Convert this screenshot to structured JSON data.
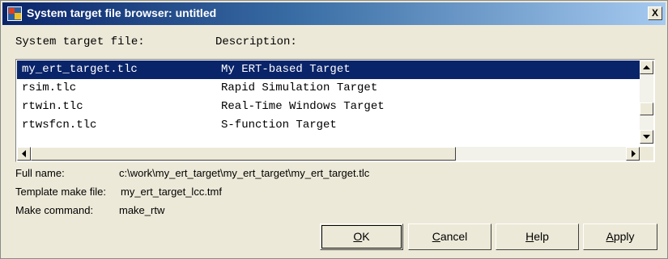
{
  "window": {
    "title": "System target file browser: untitled",
    "close_label": "X"
  },
  "columns": {
    "file": "System target file:",
    "description": "Description:"
  },
  "targets": [
    {
      "file": "my_ert_target.tlc",
      "description": "My ERT-based Target",
      "selected": true
    },
    {
      "file": "rsim.tlc",
      "description": "Rapid Simulation Target",
      "selected": false
    },
    {
      "file": "rtwin.tlc",
      "description": "Real-Time Windows Target",
      "selected": false
    },
    {
      "file": "rtwsfcn.tlc",
      "description": "S-function Target",
      "selected": false
    }
  ],
  "details": {
    "full_name_label": "Full name:",
    "full_name_value": "c:\\work\\my_ert_target\\my_ert_target\\my_ert_target.tlc",
    "template_label": "Template make file:",
    "template_value": "my_ert_target_lcc.tmf",
    "make_label": "Make command:",
    "make_value": "make_rtw"
  },
  "buttons": {
    "ok": {
      "mnemonic": "O",
      "rest": "K"
    },
    "cancel": {
      "mnemonic": "C",
      "rest": "ancel"
    },
    "help": {
      "mnemonic": "H",
      "rest": "elp"
    },
    "apply": {
      "mnemonic": "A",
      "rest": "pply"
    }
  },
  "icons": {
    "app": "simulink-app-icon",
    "close": "close-icon",
    "scroll_up": "arrow-up-icon",
    "scroll_down": "arrow-down-icon",
    "scroll_left": "arrow-left-icon",
    "scroll_right": "arrow-right-icon"
  },
  "colors": {
    "selection": "#0a246a",
    "titlebar_start": "#0a246a",
    "titlebar_end": "#a6caf0",
    "dialog_bg": "#ece9d8"
  }
}
